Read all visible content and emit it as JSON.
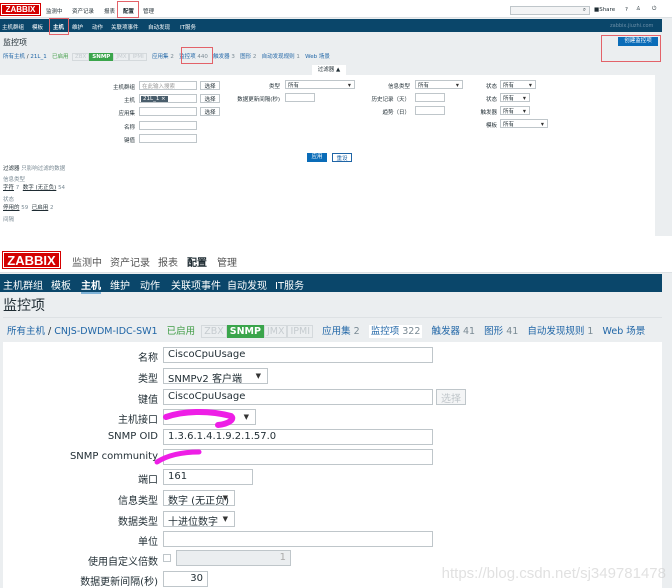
{
  "top": {
    "logo": "ZABBIX",
    "menu": [
      "监测中",
      "资产记录",
      "报表",
      "配置",
      "管理"
    ],
    "share": "Share",
    "help": "?",
    "nav": [
      "主机群组",
      "模板",
      "主机",
      "维护",
      "动作",
      "关联项事件",
      "自动发现",
      "IT服务"
    ],
    "server": "zabbix.jiuzhi.com",
    "title": "监控项",
    "create": "创建监控项",
    "breadcrumb": {
      "all": "所有主机",
      "host": "21L_1",
      "enabled": "已启用",
      "zbx": "ZBX",
      "snmp": "SNMP",
      "jmx": "JMX",
      "ipmi": "IPMI",
      "apps": "应用集",
      "apps_n": "2",
      "items": "监控项",
      "items_n": "440",
      "triggers": "触发器",
      "triggers_n": "3",
      "graphs": "图形",
      "graphs_n": "2",
      "discovery": "自动发现规则",
      "discovery_n": "1",
      "web": "Web 场景"
    },
    "filter_tab": "过滤器 ▲",
    "filter": {
      "hostgroup": "主机群组",
      "hostgroup_ph": "在此输入搜索",
      "select": "选择",
      "host": "主机",
      "host_val": "21L_1 ×",
      "app": "应用集",
      "name": "名称",
      "key": "键值",
      "type": "类型",
      "all": "所有",
      "interval": "数据更新间隔(秒)",
      "infotype": "信息类型",
      "history": "历史记录（天）",
      "trends": "趋势（日）",
      "state": "状态",
      "status": "状态",
      "triggers": "触发器",
      "template": "模板",
      "apply": "应用",
      "reset": "重设"
    },
    "summary": {
      "head": "过滤器",
      "note": "只影响过滤的数据",
      "infotype": "信息类型",
      "char": "字符",
      "char_n": "7",
      "num": "数字 (无正负)",
      "num_n": "54",
      "state": "状态",
      "disabled": "停用的",
      "disabled_n": "59",
      "enabled": "已启用",
      "enabled_n": "2",
      "interval": "间隔"
    }
  },
  "bottom": {
    "logo": "ZABBIX",
    "menu": [
      "监测中",
      "资产记录",
      "报表",
      "配置",
      "管理"
    ],
    "nav": [
      "主机群组",
      "模板",
      "主机",
      "维护",
      "动作",
      "关联项事件",
      "自动发现",
      "IT服务"
    ],
    "title": "监控项",
    "breadcrumb": {
      "all": "所有主机",
      "host": "CNJS-DWDM-IDC-SW1",
      "enabled": "已启用",
      "zbx": "ZBX",
      "snmp": "SNMP",
      "jmx": "JMX",
      "ipmi": "IPMI",
      "apps": "应用集",
      "apps_n": "2",
      "items": "监控项",
      "items_n": "322",
      "triggers": "触发器",
      "triggers_n": "41",
      "graphs": "图形",
      "graphs_n": "41",
      "discovery": "自动发现规则",
      "discovery_n": "1",
      "web": "Web 场景"
    },
    "form": {
      "name_label": "名称",
      "name": "CiscoCpuUsage",
      "type_label": "类型",
      "type": "SNMPv2 客户端",
      "key_label": "键值",
      "key": "CiscoCpuUsage",
      "select": "选择",
      "iface_label": "主机接口",
      "oid_label": "SNMP OID",
      "oid": "1.3.6.1.4.1.9.2.1.57.0",
      "community_label": "SNMP community",
      "port_label": "端口",
      "port": "161",
      "infotype_label": "信息类型",
      "infotype": "数字 (无正负)",
      "datatype_label": "数据类型",
      "datatype": "十进位数字",
      "units_label": "单位",
      "units": "",
      "multiplier_label": "使用自定义倍数",
      "multiplier": "1",
      "interval_label": "数据更新间隔(秒)",
      "interval": "30"
    }
  },
  "watermark": "https://blog.csdn.net/sj349781478"
}
